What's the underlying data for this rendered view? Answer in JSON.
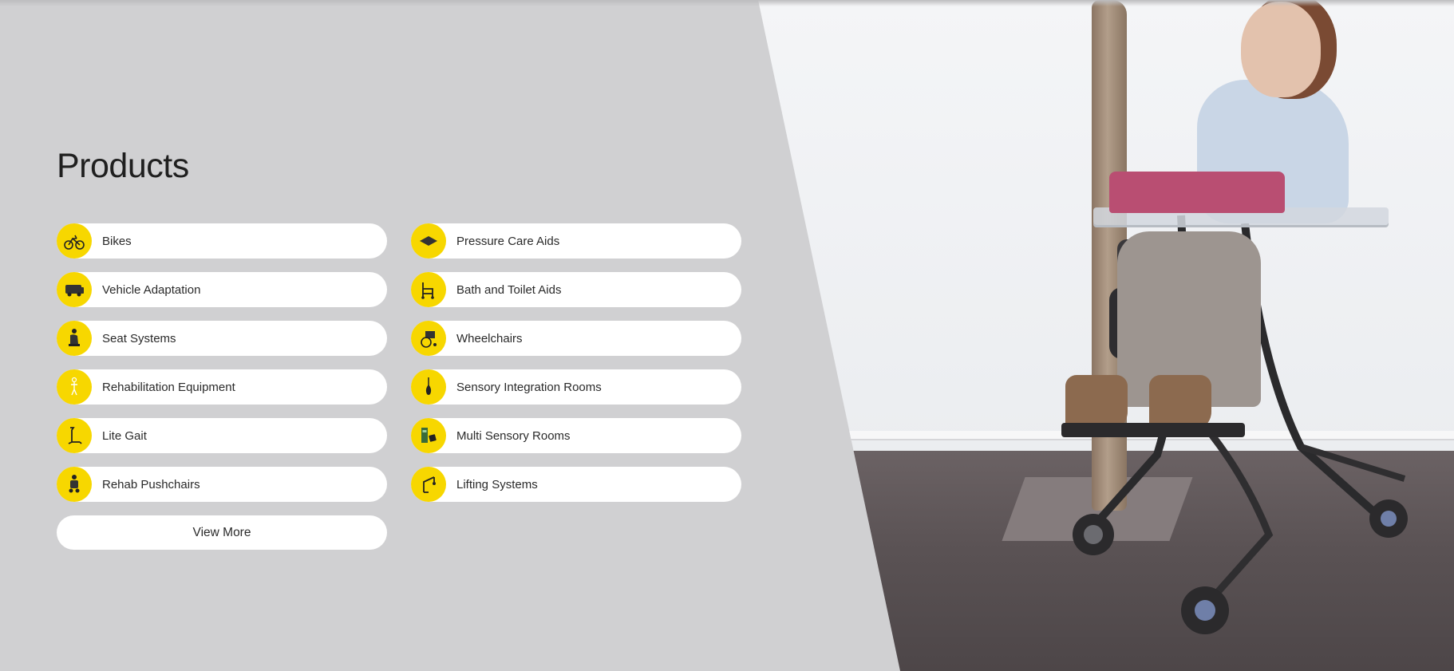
{
  "section": {
    "title": "Products"
  },
  "categories": {
    "left": [
      {
        "label": "Bikes",
        "icon": "bike-icon"
      },
      {
        "label": "Vehicle Adaptation",
        "icon": "van-icon"
      },
      {
        "label": "Seat Systems",
        "icon": "seat-icon"
      },
      {
        "label": "Rehabilitation Equipment",
        "icon": "figure-icon"
      },
      {
        "label": "Lite Gait",
        "icon": "gait-frame-icon"
      },
      {
        "label": "Rehab Pushchairs",
        "icon": "pushchair-icon"
      }
    ],
    "right": [
      {
        "label": "Pressure Care Aids",
        "icon": "cushion-icon"
      },
      {
        "label": "Bath and Toilet Aids",
        "icon": "bath-chair-icon"
      },
      {
        "label": "Wheelchairs",
        "icon": "wheelchair-icon"
      },
      {
        "label": "Sensory Integration Rooms",
        "icon": "swing-icon"
      },
      {
        "label": "Multi Sensory Rooms",
        "icon": "sensory-panel-icon"
      },
      {
        "label": "Lifting Systems",
        "icon": "hoist-icon"
      }
    ]
  },
  "view_more": {
    "label": "View More"
  },
  "colors": {
    "background": "#d0d0d2",
    "icon_circle": "#f7d700",
    "pill": "#ffffff",
    "text": "#2a2a2a"
  }
}
